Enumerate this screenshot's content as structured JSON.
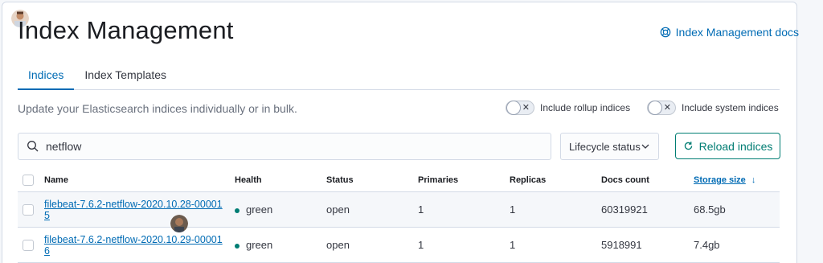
{
  "page": {
    "title": "Index Management",
    "docs_link": "Index Management docs",
    "description": "Update your Elasticsearch indices individually or in bulk."
  },
  "tabs": [
    {
      "label": "Indices",
      "active": true
    },
    {
      "label": "Index Templates",
      "active": false
    }
  ],
  "toggles": {
    "rollup": {
      "label": "Include rollup indices",
      "checked": false
    },
    "system": {
      "label": "Include system indices",
      "checked": false
    }
  },
  "search": {
    "value": "netflow"
  },
  "lifecycle_filter": {
    "label": "Lifecycle status"
  },
  "reload_button": {
    "label": "Reload indices"
  },
  "table": {
    "columns": {
      "name": "Name",
      "health": "Health",
      "status": "Status",
      "primaries": "Primaries",
      "replicas": "Replicas",
      "docs_count": "Docs count",
      "storage_size": "Storage size"
    },
    "rows": [
      {
        "name": "filebeat-7.6.2-netflow-2020.10.28-000015",
        "health": "green",
        "status": "open",
        "primaries": "1",
        "replicas": "1",
        "docs_count": "60319921",
        "storage_size": "68.5gb"
      },
      {
        "name": "filebeat-7.6.2-netflow-2020.10.29-000016",
        "health": "green",
        "status": "open",
        "primaries": "1",
        "replicas": "1",
        "docs_count": "5918991",
        "storage_size": "7.4gb"
      }
    ]
  },
  "colors": {
    "link": "#006bb4",
    "health_green": "#017d73",
    "reload_accent": "#017d73"
  }
}
